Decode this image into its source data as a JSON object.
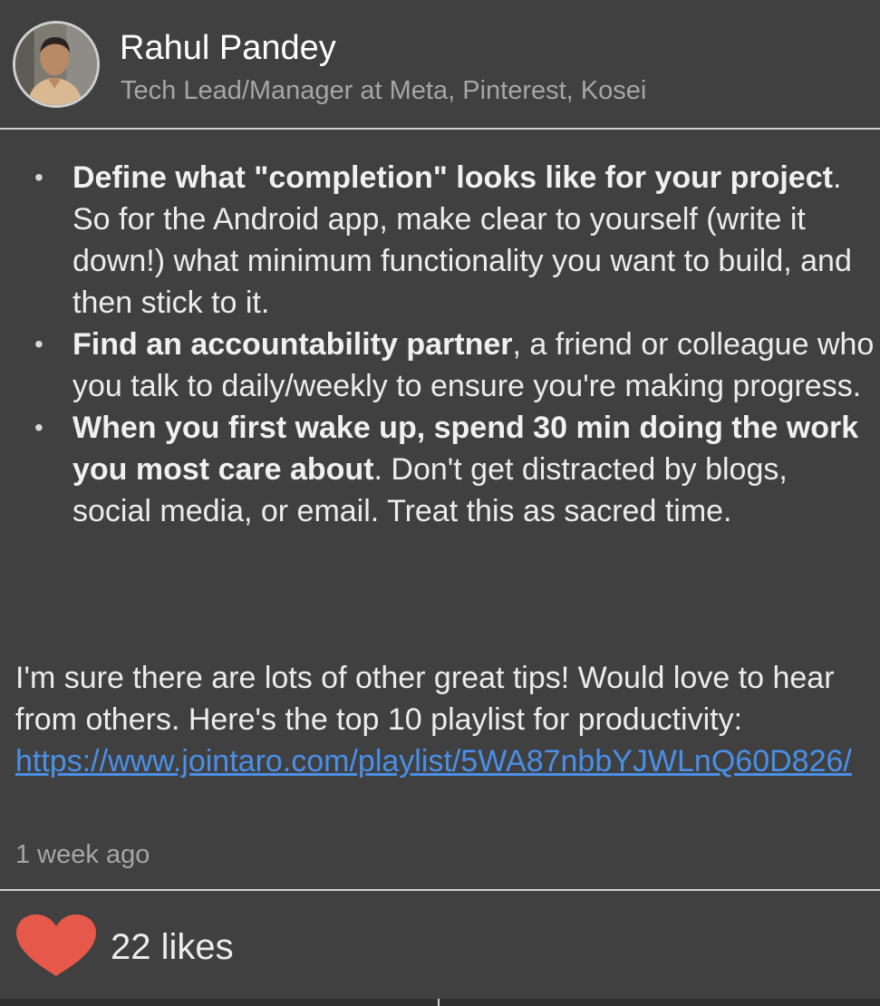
{
  "author": {
    "name": "Rahul Pandey",
    "title": "Tech Lead/Manager at Meta, Pinterest, Kosei"
  },
  "tips": [
    {
      "bold": "Define what \"completion\" looks like for your project",
      "rest": ". So for the Android app, make clear to yourself (write it down!) what minimum functionality you want to build, and then stick to it."
    },
    {
      "bold": "Find an accountability partner",
      "rest": ", a friend or colleague who you talk to daily/weekly to ensure you're making progress."
    },
    {
      "bold": "When you first wake up, spend 30 min doing the work you most care about",
      "rest": ". Don't get distracted by blogs, social media, or email. Treat this as sacred time."
    }
  ],
  "closing": {
    "text": "I'm sure there are lots of other great tips! Would love to hear from others. Here's the top 10 playlist for productivity: ",
    "link_text": "https://www.jointaro.com/playlist/5WA87nbbYJWLnQ60D826/"
  },
  "timestamp": "1 week ago",
  "likes": {
    "label": "22 likes",
    "heart_color": "#e5584a"
  },
  "colors": {
    "background": "#404040",
    "link": "#4a8fe8",
    "muted_text": "#a6a6a6"
  }
}
